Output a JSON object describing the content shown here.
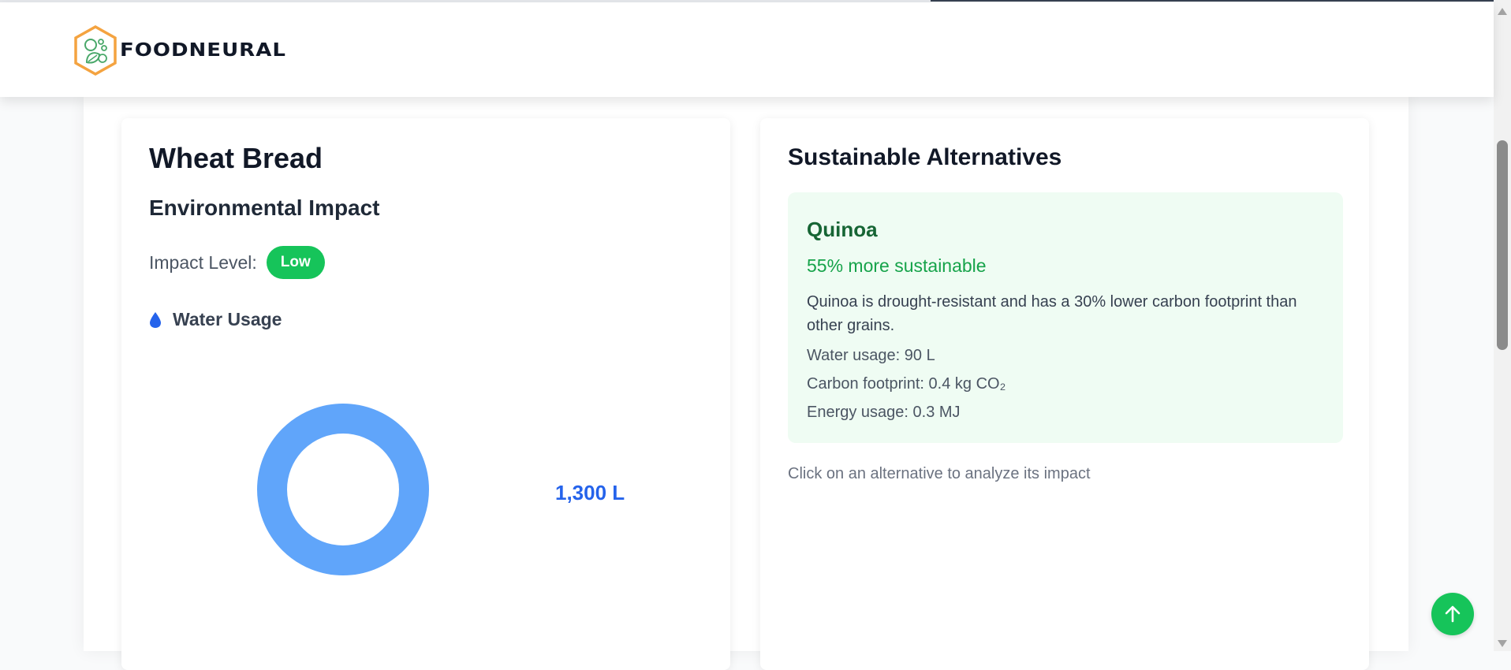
{
  "app": {
    "logo_text": "FOODNEURAL",
    "brand_colors": {
      "logo_orange": "#f4a340",
      "logo_green": "#4aa86a",
      "accent_green": "#16c45a",
      "accent_blue": "#2563eb"
    }
  },
  "food": {
    "name": "Wheat Bread",
    "section_title": "Environmental Impact",
    "impact_label": "Impact Level:",
    "impact_level": "Low",
    "metric": {
      "icon": "water-drop-icon",
      "label": "Water Usage",
      "value_text": "1,300 L",
      "ring_color": "#60a5fa"
    }
  },
  "alternatives": {
    "title": "Sustainable Alternatives",
    "items": [
      {
        "name": "Quinoa",
        "sustainability": "55% more sustainable",
        "description": "Quinoa is drought-resistant and has a 30% lower carbon footprint than other grains.",
        "water_usage": "Water usage: 90 L",
        "carbon_footprint": "Carbon footprint: 0.4 kg CO₂",
        "energy_usage": "Energy usage: 0.3 MJ"
      }
    ],
    "hint": "Click on an alternative to analyze its impact"
  },
  "controls": {
    "back_to_top_icon": "arrow-up-icon"
  }
}
